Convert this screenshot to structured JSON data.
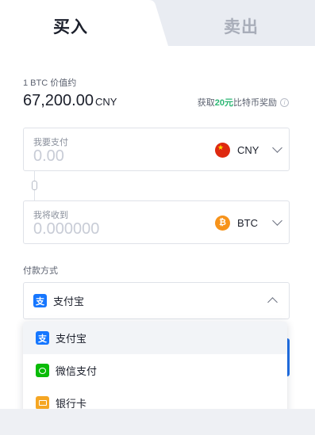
{
  "tabs": {
    "buy": "买入",
    "sell": "卖出"
  },
  "price": {
    "label": "1 BTC 价值约",
    "value": "67,200.00",
    "currency": "CNY",
    "reward_prefix": "获取",
    "reward_amount": "20元",
    "reward_suffix": "比特币奖励",
    "info_glyph": "i"
  },
  "pay_field": {
    "label": "我要支付",
    "placeholder": "0.00",
    "currency": "CNY",
    "flag_icon": "china-flag-icon"
  },
  "receive_field": {
    "label": "我将收到",
    "placeholder": "0.000000",
    "currency": "BTC",
    "coin_glyph": "₿"
  },
  "payment_method": {
    "label": "付款方式",
    "selected": "支付宝",
    "selected_icon_glyph": "支",
    "options": [
      {
        "label": "支付宝",
        "icon": "alipay-icon",
        "glyph": "支"
      },
      {
        "label": "微信支付",
        "icon": "wechat-icon",
        "glyph": ""
      },
      {
        "label": "银行卡",
        "icon": "bank-card-icon",
        "glyph": ""
      }
    ]
  },
  "colors": {
    "accent_green": "#2bb673",
    "primary_blue": "#1f6fe5",
    "alipay_blue": "#1677ff",
    "wechat_green": "#09bb07",
    "bank_orange": "#f5a623",
    "btc_orange": "#f7931a",
    "cny_red": "#de2910"
  }
}
